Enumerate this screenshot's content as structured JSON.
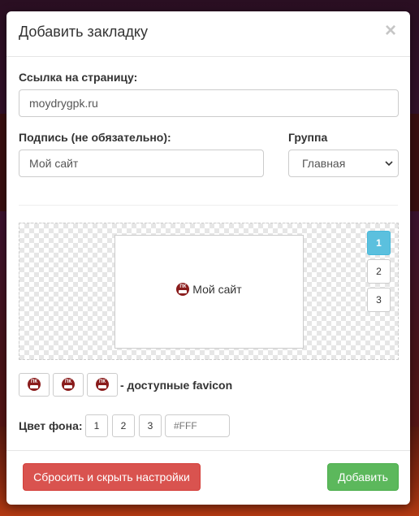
{
  "modal": {
    "title": "Добавить закладку",
    "close_glyph": "×"
  },
  "form": {
    "url_label": "Ссылка на страницу:",
    "url_value": "moydrygpk.ru",
    "caption_label": "Подпись (не обязательно):",
    "caption_value": "Мой сайт",
    "group_label": "Группа",
    "group_selected": "Главная"
  },
  "preview": {
    "tile_text": "Мой сайт",
    "favicon_text": "ПК",
    "page_buttons": [
      "1",
      "2",
      "3"
    ],
    "active_page": "1"
  },
  "favicons": {
    "caption": "- доступные favicon",
    "count": 3
  },
  "background": {
    "label": "Цвет фона:",
    "options": [
      "1",
      "2",
      "3"
    ],
    "color_placeholder": "#FFF"
  },
  "footer": {
    "reset_label": "Сбросить и скрыть настройки",
    "add_label": "Добавить"
  },
  "colors": {
    "info": "#5bc0de",
    "danger": "#d9534f",
    "success": "#5cb85c",
    "favicon": "#8a1c1c"
  },
  "icons": {
    "close": "close-icon",
    "select_arrow": "chevron-down-icon",
    "site_favicon": "site-favicon-icon"
  }
}
